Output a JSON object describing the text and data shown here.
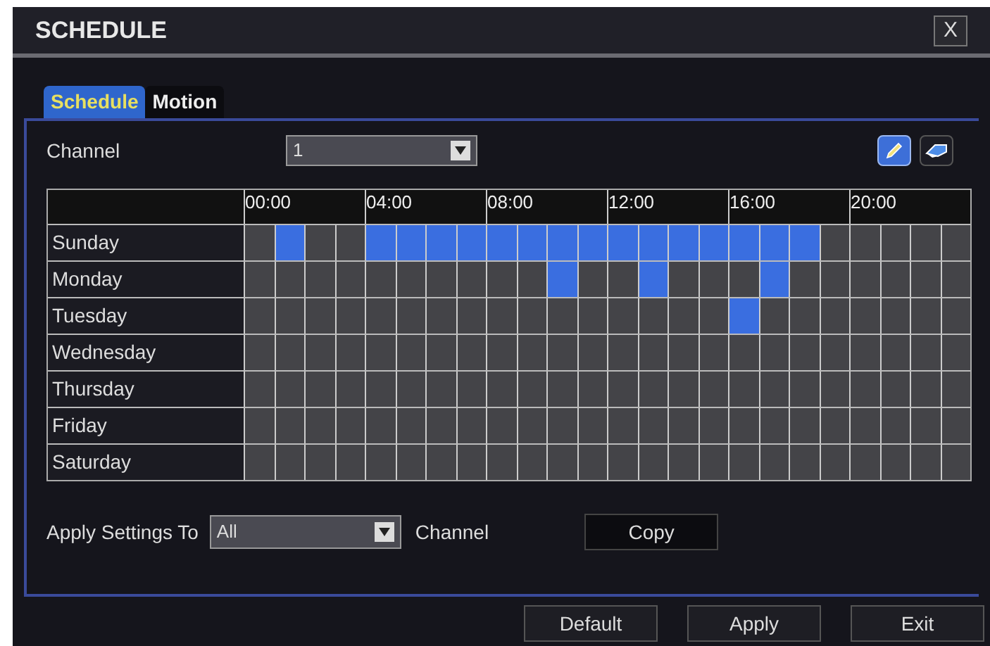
{
  "window": {
    "title": "SCHEDULE",
    "close": "X"
  },
  "tabs": [
    {
      "label": "Schedule",
      "selected": true
    },
    {
      "label": "Motion",
      "selected": false
    }
  ],
  "channel": {
    "label": "Channel",
    "value": "1"
  },
  "toolbar": [
    {
      "kind": "pencil",
      "selected": true
    },
    {
      "kind": "eraser",
      "selected": false
    }
  ],
  "schedule": {
    "hour_labels": [
      "00:00",
      "04:00",
      "08:00",
      "12:00",
      "16:00",
      "20:00"
    ],
    "days": [
      {
        "name": "Sunday",
        "cells": [
          false,
          true,
          false,
          false,
          true,
          true,
          true,
          true,
          true,
          true,
          true,
          true,
          true,
          true,
          true,
          true,
          true,
          true,
          true,
          false,
          false,
          false,
          false,
          false
        ]
      },
      {
        "name": "Monday",
        "cells": [
          false,
          false,
          false,
          false,
          false,
          false,
          false,
          false,
          false,
          false,
          true,
          false,
          false,
          true,
          false,
          false,
          false,
          true,
          false,
          false,
          false,
          false,
          false,
          false
        ]
      },
      {
        "name": "Tuesday",
        "cells": [
          false,
          false,
          false,
          false,
          false,
          false,
          false,
          false,
          false,
          false,
          false,
          false,
          false,
          false,
          false,
          false,
          true,
          false,
          false,
          false,
          false,
          false,
          false,
          false
        ]
      },
      {
        "name": "Wednesday",
        "cells": [
          false,
          false,
          false,
          false,
          false,
          false,
          false,
          false,
          false,
          false,
          false,
          false,
          false,
          false,
          false,
          false,
          false,
          false,
          false,
          false,
          false,
          false,
          false,
          false
        ]
      },
      {
        "name": "Thursday",
        "cells": [
          false,
          false,
          false,
          false,
          false,
          false,
          false,
          false,
          false,
          false,
          false,
          false,
          false,
          false,
          false,
          false,
          false,
          false,
          false,
          false,
          false,
          false,
          false,
          false
        ]
      },
      {
        "name": "Friday",
        "cells": [
          false,
          false,
          false,
          false,
          false,
          false,
          false,
          false,
          false,
          false,
          false,
          false,
          false,
          false,
          false,
          false,
          false,
          false,
          false,
          false,
          false,
          false,
          false,
          false
        ]
      },
      {
        "name": "Saturday",
        "cells": [
          false,
          false,
          false,
          false,
          false,
          false,
          false,
          false,
          false,
          false,
          false,
          false,
          false,
          false,
          false,
          false,
          false,
          false,
          false,
          false,
          false,
          false,
          false,
          false
        ]
      }
    ]
  },
  "apply": {
    "label": "Apply Settings To",
    "value": "All",
    "suffix": "Channel",
    "copy": "Copy"
  },
  "buttons": [
    "Default",
    "Apply",
    "Exit"
  ]
}
